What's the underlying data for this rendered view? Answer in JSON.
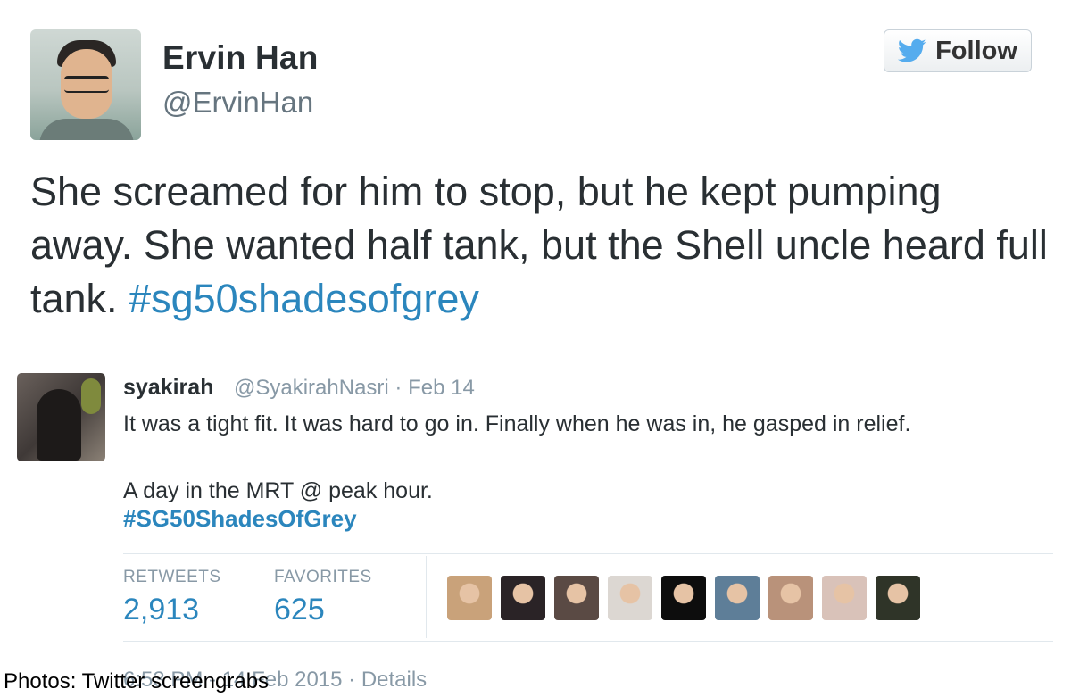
{
  "tweet": {
    "author_name": "Ervin Han",
    "author_handle": "@ErvinHan",
    "follow_label": "Follow",
    "text_main": "She screamed for him to stop, but he kept pumping away. She wanted half tank, but the Shell uncle heard full tank. ",
    "hashtag": "#sg50shadesofgrey"
  },
  "embedded": {
    "name": "syakirah",
    "handle_date": "@SyakirahNasri · Feb 14",
    "line1": "It was a tight fit. It was hard to go in. Finally when he was in, he gasped in relief.",
    "line2": "A day in the MRT @ peak hour.",
    "hashtag": "#SG50ShadesOfGrey"
  },
  "stats": {
    "retweets_label": "RETWEETS",
    "retweets_value": "2,913",
    "favorites_label": "FAVORITES",
    "favorites_value": "625"
  },
  "favoriters": [
    {
      "icon": "avatar-icon",
      "color": "#c9a27a"
    },
    {
      "icon": "avatar-icon",
      "color": "#2a2326"
    },
    {
      "icon": "avatar-icon",
      "color": "#5a4a44"
    },
    {
      "icon": "avatar-icon",
      "color": "#dcd7d2"
    },
    {
      "icon": "avatar-icon",
      "color": "#0d0d0d"
    },
    {
      "icon": "avatar-icon",
      "color": "#5e7e98"
    },
    {
      "icon": "avatar-icon",
      "color": "#b9927a"
    },
    {
      "icon": "avatar-icon",
      "color": "#d9c2b9"
    },
    {
      "icon": "avatar-icon",
      "color": "#2f3428"
    }
  ],
  "footer": {
    "timestamp": "6:53 PM - 14 Feb 2015 · Details"
  },
  "caption": "Photos: Twitter screengrabs",
  "colors": {
    "hashtag": "#2b86bd",
    "twitter_bird": "#55acee",
    "text": "#292f33",
    "muted": "#8899a6"
  }
}
